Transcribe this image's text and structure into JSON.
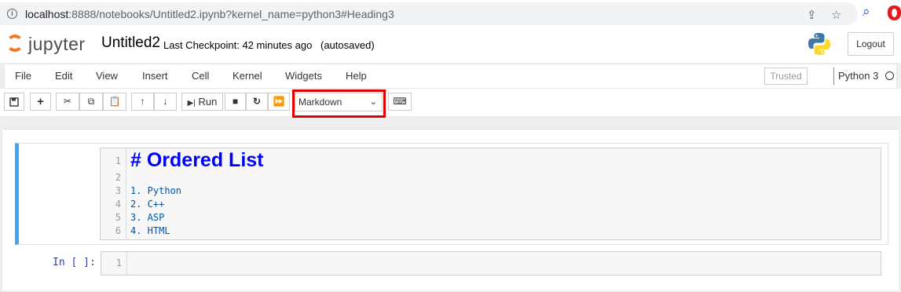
{
  "browser": {
    "url_host": "localhost",
    "url_rest": ":8888/notebooks/Untitled2.ipynb?kernel_name=python3#Heading3"
  },
  "header": {
    "logo_text": "jupyter",
    "notebook_name": "Untitled2",
    "checkpoint": "Last Checkpoint: 42 minutes ago",
    "autosave": "(autosaved)",
    "logout_label": "Logout"
  },
  "menu": {
    "items": [
      "File",
      "Edit",
      "View",
      "Insert",
      "Cell",
      "Kernel",
      "Widgets",
      "Help"
    ],
    "trusted": "Trusted",
    "kernel_name": "Python 3"
  },
  "toolbar": {
    "run_label": "Run",
    "cell_type": "Markdown",
    "icons": [
      "save-icon",
      "plus-icon",
      "cut-icon",
      "copy-icon",
      "paste-icon",
      "arrow-up-icon",
      "arrow-down-icon",
      "run-icon",
      "stop-icon",
      "restart-icon",
      "fast-forward-icon",
      "keyboard-icon"
    ]
  },
  "cells": [
    {
      "lines": [
        {
          "num": "1",
          "text": "# Ordered List"
        },
        {
          "num": "2",
          "text": ""
        },
        {
          "num": "3",
          "text": "1. Python"
        },
        {
          "num": "4",
          "text": "2. C++"
        },
        {
          "num": "5",
          "text": "3. ASP"
        },
        {
          "num": "6",
          "text": "4. HTML"
        }
      ]
    },
    {
      "prompt": "In [ ]:",
      "lines": [
        {
          "num": "1",
          "text": ""
        }
      ]
    }
  ],
  "colors": {
    "accent_selected": "#42a5f5",
    "highlight_box": "#e30000",
    "heading": "#0000ff",
    "jupyter_orange": "#f37726"
  }
}
